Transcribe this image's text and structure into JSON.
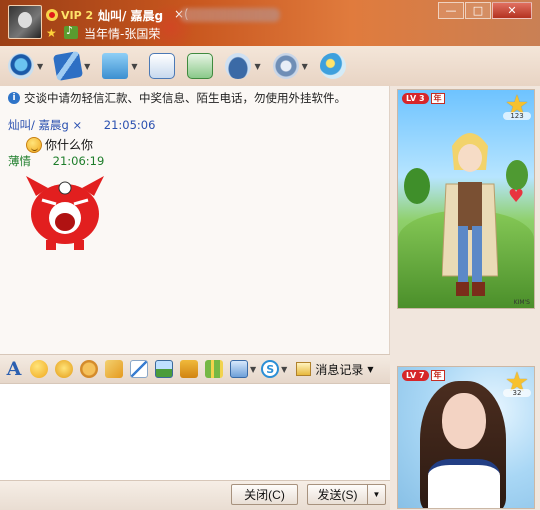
{
  "window": {
    "vip_label": "VIP 2",
    "contact_nick": "灿叫/ 嘉晨g",
    "email_prefix": "×(",
    "status_text": "当年情-张国荣",
    "controls": {
      "minimize": "—",
      "maximize": "□",
      "close": "✕"
    }
  },
  "toolbar": {
    "items": [
      {
        "name": "video",
        "icon": "webcam-icon"
      },
      {
        "name": "voice",
        "icon": "microphone-icon"
      },
      {
        "name": "file",
        "icon": "folder-icon"
      },
      {
        "name": "mail",
        "icon": "mail-icon"
      },
      {
        "name": "note",
        "icon": "note-icon"
      },
      {
        "name": "vip",
        "icon": "graduation-hat-icon"
      },
      {
        "name": "app",
        "icon": "gear-app-icon"
      },
      {
        "name": "qzone",
        "icon": "globe-icon"
      }
    ]
  },
  "chat": {
    "notice": "交谈中请勿轻信汇款、中奖信息、陌生电话，勿使用外挂软件。",
    "messages": [
      {
        "sender": "灿叫/ 嘉晨g  ×",
        "time": "21:05:06",
        "text": "你什么你",
        "sender_color": "#2a50b0"
      },
      {
        "sender": "薄情",
        "time": "21:06:19",
        "sticker": "angry-red-cat",
        "sender_color": "#1d7d2a"
      }
    ]
  },
  "input_toolbar": {
    "history_label": "消息记录"
  },
  "input": {
    "value": "",
    "placeholder": ""
  },
  "buttons": {
    "close": "关闭(C)",
    "send": "发送(S)",
    "send_dropdown": "▼"
  },
  "right_panel": {
    "show1": {
      "level": "LV 3",
      "year": "年",
      "stars": "123",
      "watermark": "KIM'S"
    },
    "show2": {
      "level": "LV 7",
      "year": "年",
      "stars": "32"
    }
  }
}
